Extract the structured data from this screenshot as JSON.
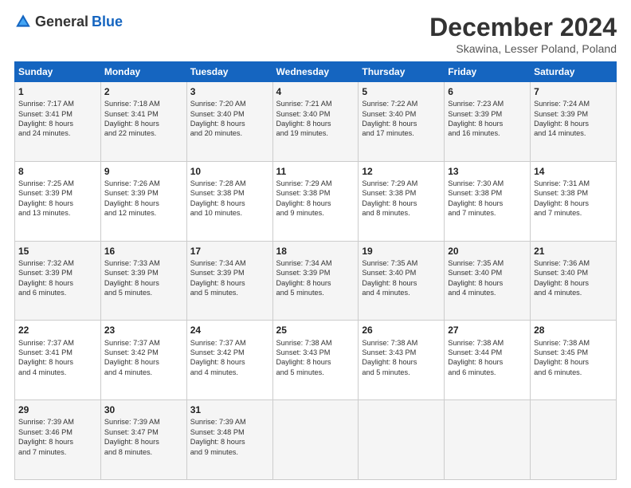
{
  "logo": {
    "general": "General",
    "blue": "Blue"
  },
  "header": {
    "month": "December 2024",
    "location": "Skawina, Lesser Poland, Poland"
  },
  "columns": [
    "Sunday",
    "Monday",
    "Tuesday",
    "Wednesday",
    "Thursday",
    "Friday",
    "Saturday"
  ],
  "weeks": [
    [
      {
        "day": "1",
        "lines": [
          "Sunrise: 7:17 AM",
          "Sunset: 3:41 PM",
          "Daylight: 8 hours",
          "and 24 minutes."
        ]
      },
      {
        "day": "2",
        "lines": [
          "Sunrise: 7:18 AM",
          "Sunset: 3:41 PM",
          "Daylight: 8 hours",
          "and 22 minutes."
        ]
      },
      {
        "day": "3",
        "lines": [
          "Sunrise: 7:20 AM",
          "Sunset: 3:40 PM",
          "Daylight: 8 hours",
          "and 20 minutes."
        ]
      },
      {
        "day": "4",
        "lines": [
          "Sunrise: 7:21 AM",
          "Sunset: 3:40 PM",
          "Daylight: 8 hours",
          "and 19 minutes."
        ]
      },
      {
        "day": "5",
        "lines": [
          "Sunrise: 7:22 AM",
          "Sunset: 3:40 PM",
          "Daylight: 8 hours",
          "and 17 minutes."
        ]
      },
      {
        "day": "6",
        "lines": [
          "Sunrise: 7:23 AM",
          "Sunset: 3:39 PM",
          "Daylight: 8 hours",
          "and 16 minutes."
        ]
      },
      {
        "day": "7",
        "lines": [
          "Sunrise: 7:24 AM",
          "Sunset: 3:39 PM",
          "Daylight: 8 hours",
          "and 14 minutes."
        ]
      }
    ],
    [
      {
        "day": "8",
        "lines": [
          "Sunrise: 7:25 AM",
          "Sunset: 3:39 PM",
          "Daylight: 8 hours",
          "and 13 minutes."
        ]
      },
      {
        "day": "9",
        "lines": [
          "Sunrise: 7:26 AM",
          "Sunset: 3:39 PM",
          "Daylight: 8 hours",
          "and 12 minutes."
        ]
      },
      {
        "day": "10",
        "lines": [
          "Sunrise: 7:28 AM",
          "Sunset: 3:38 PM",
          "Daylight: 8 hours",
          "and 10 minutes."
        ]
      },
      {
        "day": "11",
        "lines": [
          "Sunrise: 7:29 AM",
          "Sunset: 3:38 PM",
          "Daylight: 8 hours",
          "and 9 minutes."
        ]
      },
      {
        "day": "12",
        "lines": [
          "Sunrise: 7:29 AM",
          "Sunset: 3:38 PM",
          "Daylight: 8 hours",
          "and 8 minutes."
        ]
      },
      {
        "day": "13",
        "lines": [
          "Sunrise: 7:30 AM",
          "Sunset: 3:38 PM",
          "Daylight: 8 hours",
          "and 7 minutes."
        ]
      },
      {
        "day": "14",
        "lines": [
          "Sunrise: 7:31 AM",
          "Sunset: 3:38 PM",
          "Daylight: 8 hours",
          "and 7 minutes."
        ]
      }
    ],
    [
      {
        "day": "15",
        "lines": [
          "Sunrise: 7:32 AM",
          "Sunset: 3:39 PM",
          "Daylight: 8 hours",
          "and 6 minutes."
        ]
      },
      {
        "day": "16",
        "lines": [
          "Sunrise: 7:33 AM",
          "Sunset: 3:39 PM",
          "Daylight: 8 hours",
          "and 5 minutes."
        ]
      },
      {
        "day": "17",
        "lines": [
          "Sunrise: 7:34 AM",
          "Sunset: 3:39 PM",
          "Daylight: 8 hours",
          "and 5 minutes."
        ]
      },
      {
        "day": "18",
        "lines": [
          "Sunrise: 7:34 AM",
          "Sunset: 3:39 PM",
          "Daylight: 8 hours",
          "and 5 minutes."
        ]
      },
      {
        "day": "19",
        "lines": [
          "Sunrise: 7:35 AM",
          "Sunset: 3:40 PM",
          "Daylight: 8 hours",
          "and 4 minutes."
        ]
      },
      {
        "day": "20",
        "lines": [
          "Sunrise: 7:35 AM",
          "Sunset: 3:40 PM",
          "Daylight: 8 hours",
          "and 4 minutes."
        ]
      },
      {
        "day": "21",
        "lines": [
          "Sunrise: 7:36 AM",
          "Sunset: 3:40 PM",
          "Daylight: 8 hours",
          "and 4 minutes."
        ]
      }
    ],
    [
      {
        "day": "22",
        "lines": [
          "Sunrise: 7:37 AM",
          "Sunset: 3:41 PM",
          "Daylight: 8 hours",
          "and 4 minutes."
        ]
      },
      {
        "day": "23",
        "lines": [
          "Sunrise: 7:37 AM",
          "Sunset: 3:42 PM",
          "Daylight: 8 hours",
          "and 4 minutes."
        ]
      },
      {
        "day": "24",
        "lines": [
          "Sunrise: 7:37 AM",
          "Sunset: 3:42 PM",
          "Daylight: 8 hours",
          "and 4 minutes."
        ]
      },
      {
        "day": "25",
        "lines": [
          "Sunrise: 7:38 AM",
          "Sunset: 3:43 PM",
          "Daylight: 8 hours",
          "and 5 minutes."
        ]
      },
      {
        "day": "26",
        "lines": [
          "Sunrise: 7:38 AM",
          "Sunset: 3:43 PM",
          "Daylight: 8 hours",
          "and 5 minutes."
        ]
      },
      {
        "day": "27",
        "lines": [
          "Sunrise: 7:38 AM",
          "Sunset: 3:44 PM",
          "Daylight: 8 hours",
          "and 6 minutes."
        ]
      },
      {
        "day": "28",
        "lines": [
          "Sunrise: 7:38 AM",
          "Sunset: 3:45 PM",
          "Daylight: 8 hours",
          "and 6 minutes."
        ]
      }
    ],
    [
      {
        "day": "29",
        "lines": [
          "Sunrise: 7:39 AM",
          "Sunset: 3:46 PM",
          "Daylight: 8 hours",
          "and 7 minutes."
        ]
      },
      {
        "day": "30",
        "lines": [
          "Sunrise: 7:39 AM",
          "Sunset: 3:47 PM",
          "Daylight: 8 hours",
          "and 8 minutes."
        ]
      },
      {
        "day": "31",
        "lines": [
          "Sunrise: 7:39 AM",
          "Sunset: 3:48 PM",
          "Daylight: 8 hours",
          "and 9 minutes."
        ]
      },
      null,
      null,
      null,
      null
    ]
  ]
}
